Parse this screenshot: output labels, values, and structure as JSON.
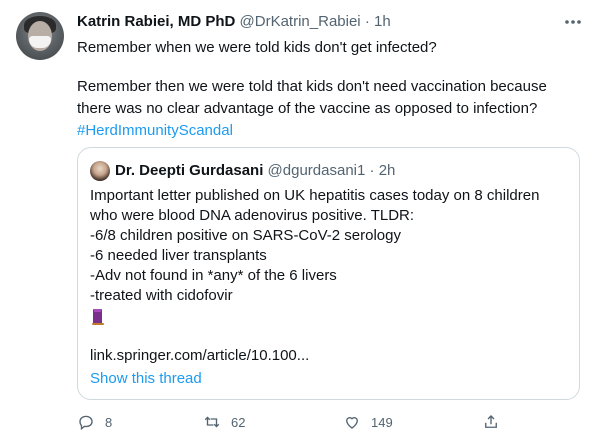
{
  "tweet": {
    "author_name": "Katrin Rabiei, MD PhD",
    "author_handle": "@DrKatrin_Rabiei",
    "separator": "·",
    "time": "1h",
    "lines": [
      "Remember when we were told kids don't get infected?",
      "Remember then we were told that kids don't need vaccination because there was no clear  advantage of the vaccine as opposed to infection?"
    ],
    "hashtag": "#HerdImmunityScandal"
  },
  "quote": {
    "author_name": "Dr. Deepti Gurdasani",
    "author_handle": "@dgurdasani1",
    "separator": "·",
    "time": "2h",
    "lines": [
      "Important letter published on UK hepatitis cases today on 8 children",
      "who were blood DNA adenovirus positive. TLDR:",
      "-6/8 children positive on SARS-CoV-2 serology",
      "-6 needed liver transplants",
      "-Adv not found in *any* of the 6 livers",
      "-treated with cidofovir"
    ],
    "emoji": "test-tube/scroll emoji",
    "link": "link.springer.com/article/10.100...",
    "show_thread": "Show this thread"
  },
  "actions": {
    "reply_count": "8",
    "retweet_count": "62",
    "like_count": "149"
  },
  "colors": {
    "accent": "#1d9bf0",
    "secondary_text": "#536471",
    "border": "#cfd9de"
  }
}
